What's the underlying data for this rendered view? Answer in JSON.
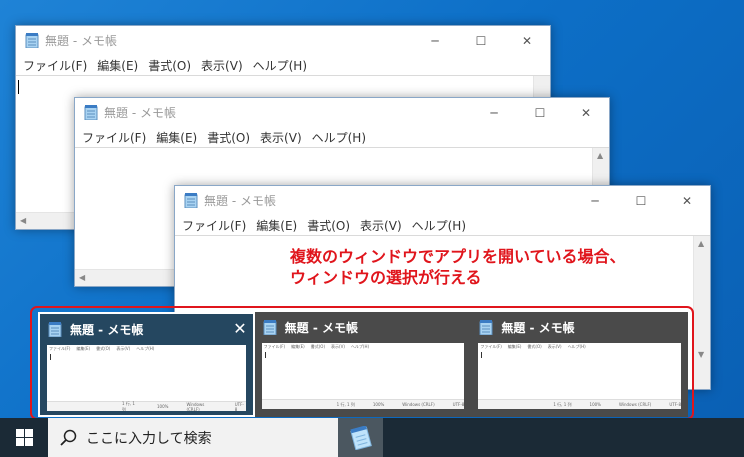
{
  "windows": [
    {
      "title": "無題 - メモ帳"
    },
    {
      "title": "無題 - メモ帳"
    },
    {
      "title": "無題 - メモ帳"
    }
  ],
  "menu": [
    "ファイル(F)",
    "編集(E)",
    "書式(O)",
    "表示(V)",
    "ヘルプ(H)"
  ],
  "annotation": {
    "line1": "複数のウィンドウでアプリを開いている場合、",
    "line2": "ウィンドウの選択が行える"
  },
  "thumbnails": [
    {
      "title": "無題 - メモ帳",
      "active": true
    },
    {
      "title": "無題 - メモ帳",
      "active": false
    },
    {
      "title": "無題 - メモ帳",
      "active": false
    }
  ],
  "mini_status": {
    "pos": "1 行, 1 列",
    "zoom": "100%",
    "eol": "Windows (CRLF)",
    "enc": "UTF-8"
  },
  "taskbar": {
    "search_placeholder": "ここに入力して検索"
  },
  "colors": {
    "annotation": "#e0151c",
    "taskbar": "#1b2a36",
    "desktop": "#0d6fc7"
  }
}
